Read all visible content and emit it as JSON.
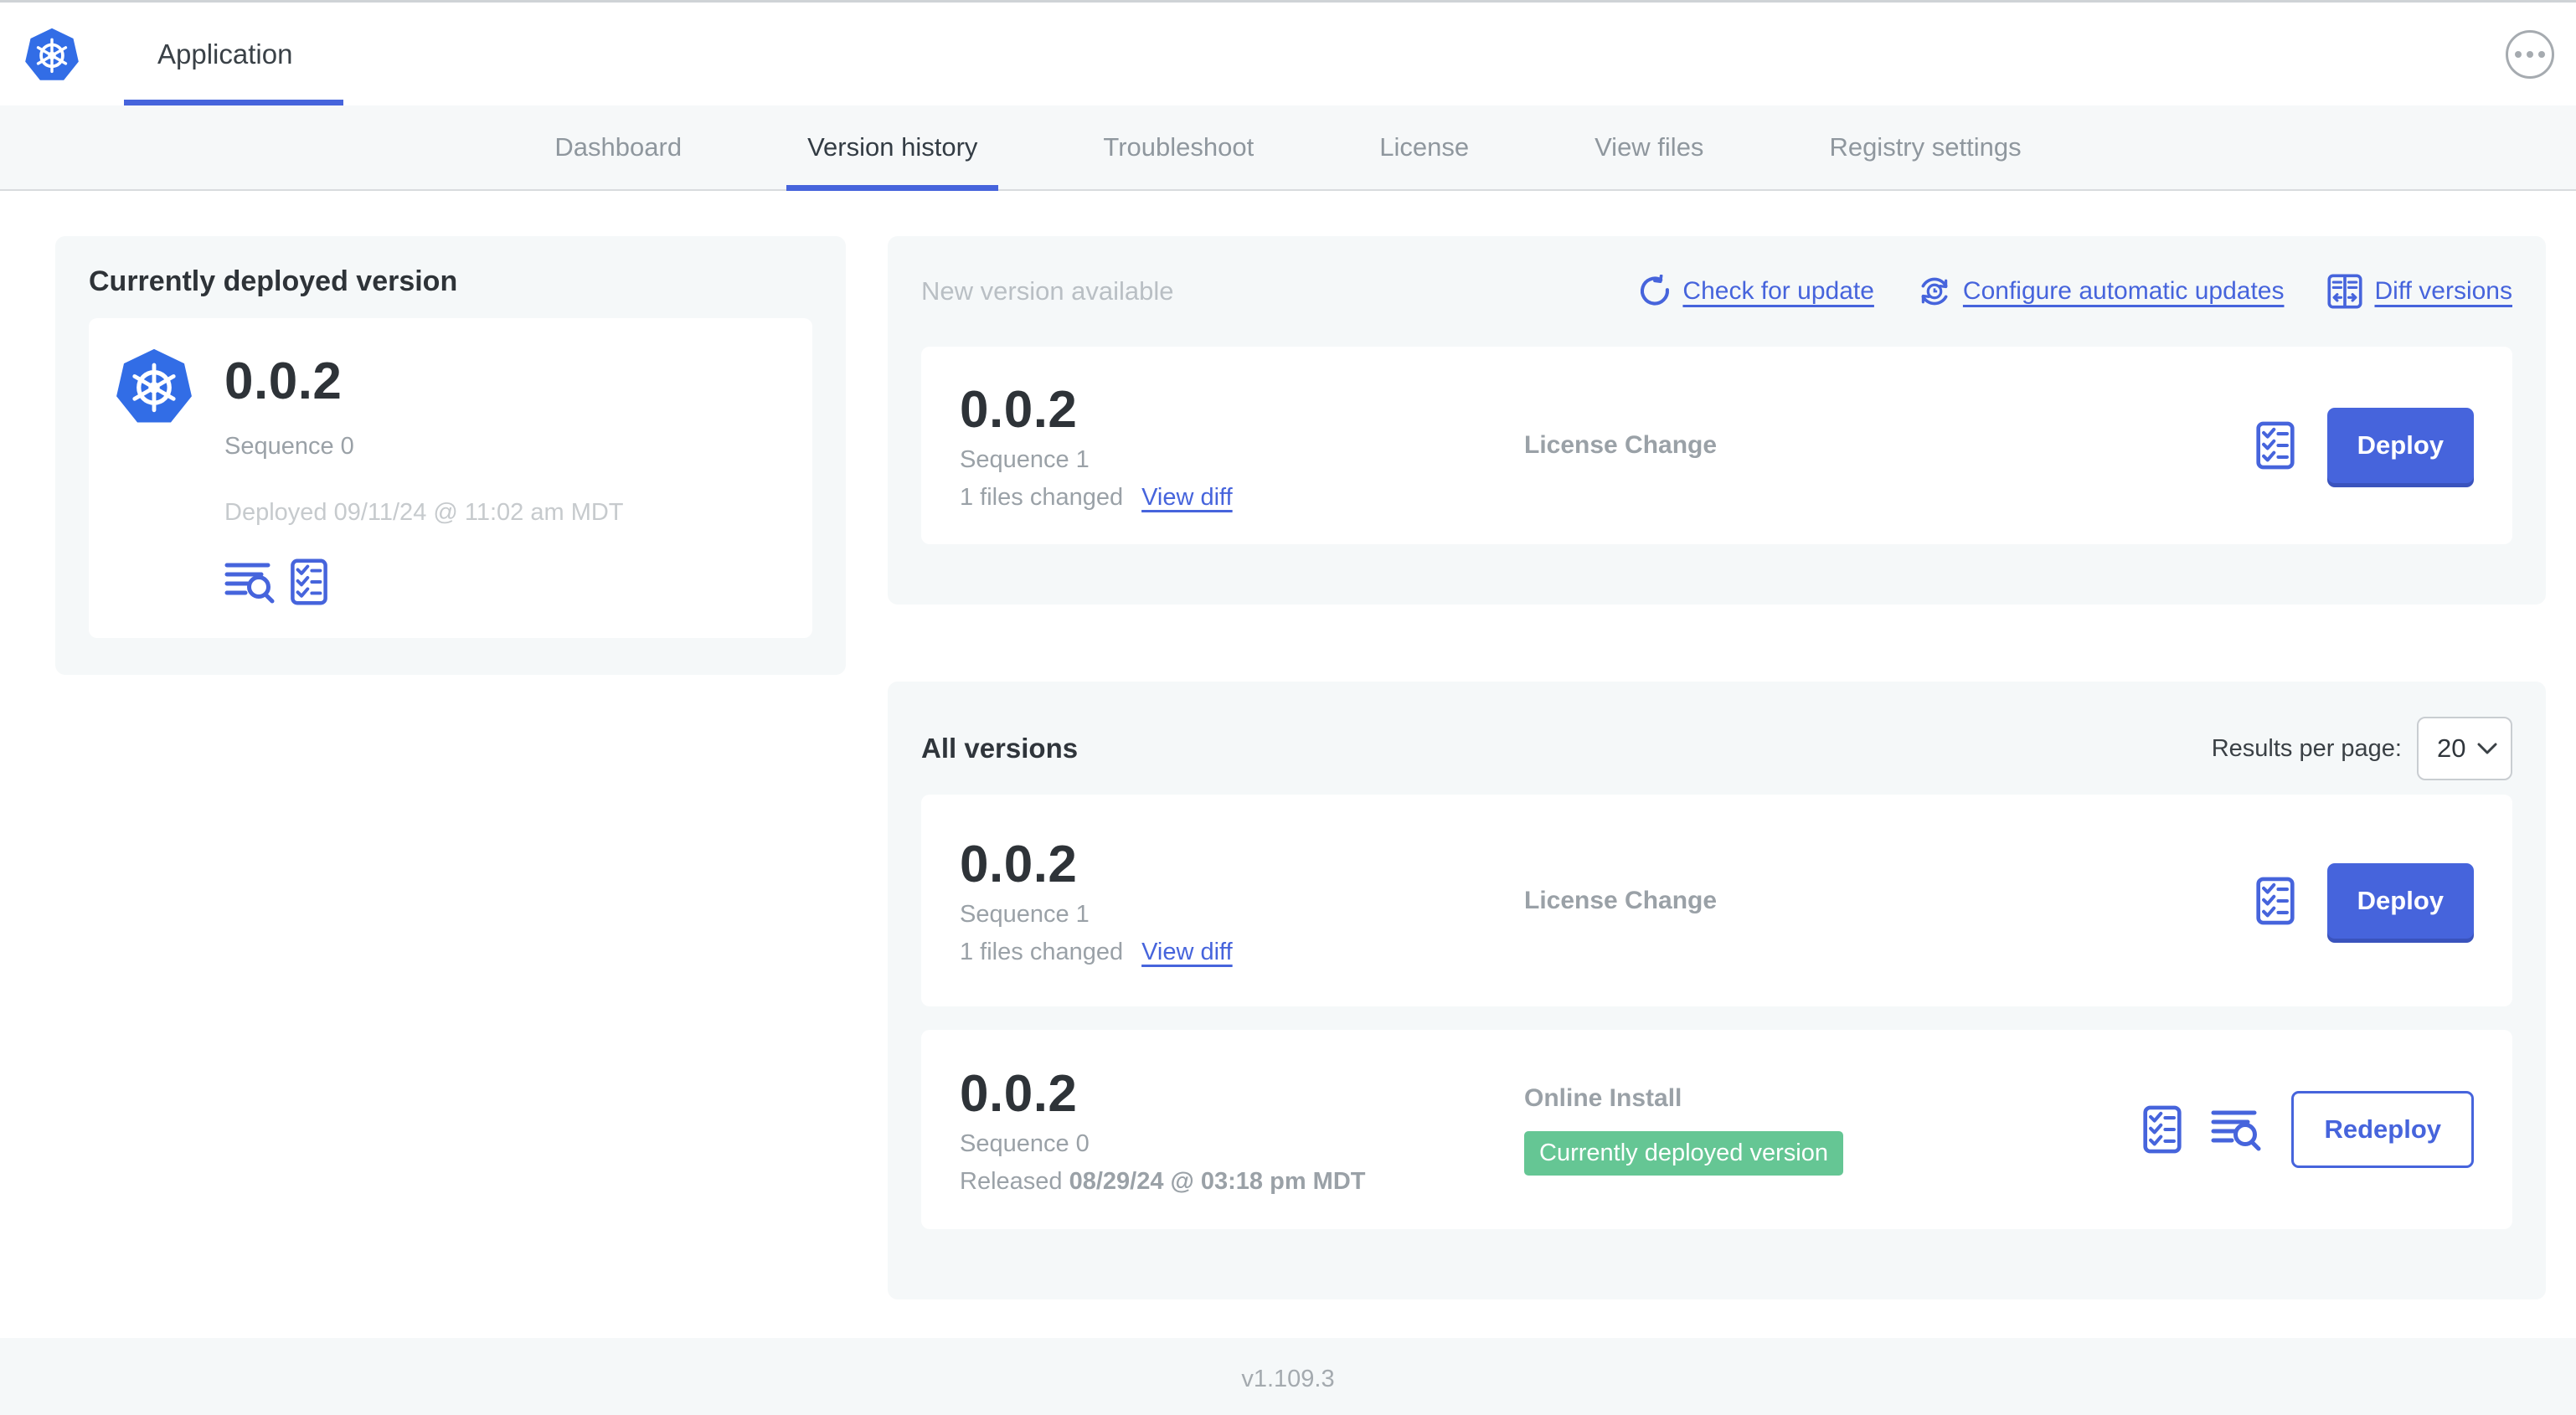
{
  "colors": {
    "accent": "#4664DC",
    "badge_green": "#65C694",
    "k8s_blue": "#326DE6"
  },
  "header": {
    "app_title": "Application"
  },
  "nav": {
    "tabs": [
      {
        "label": "Dashboard"
      },
      {
        "label": "Version history"
      },
      {
        "label": "Troubleshoot"
      },
      {
        "label": "License"
      },
      {
        "label": "View files"
      },
      {
        "label": "Registry settings"
      }
    ]
  },
  "deployed_card": {
    "title": "Currently deployed version",
    "version": "0.0.2",
    "sequence": "Sequence 0",
    "deployed_at": "Deployed 09/11/24 @ 11:02 am MDT"
  },
  "new_version": {
    "title": "New version available",
    "check_for_update": "Check for update",
    "configure_updates": "Configure automatic updates",
    "diff_versions": "Diff versions",
    "row": {
      "version": "0.0.2",
      "sequence": "Sequence 1",
      "files_changed": "1 files changed",
      "view_diff": "View diff",
      "source": "License Change",
      "deploy": "Deploy"
    }
  },
  "all_versions": {
    "title": "All versions",
    "results_per_page_label": "Results per page:",
    "results_per_page_value": "20",
    "rows": [
      {
        "version": "0.0.2",
        "sequence": "Sequence 1",
        "files_changed": "1 files changed",
        "view_diff": "View diff",
        "source": "License Change",
        "deploy": "Deploy"
      },
      {
        "version": "0.0.2",
        "sequence": "Sequence 0",
        "released_prefix": "Released ",
        "released_date": "08/29/24 @ 03:18 pm MDT",
        "source": "Online Install",
        "badge": "Currently deployed version",
        "redeploy": "Redeploy"
      }
    ]
  },
  "footer": {
    "app_version": "v1.109.3"
  }
}
